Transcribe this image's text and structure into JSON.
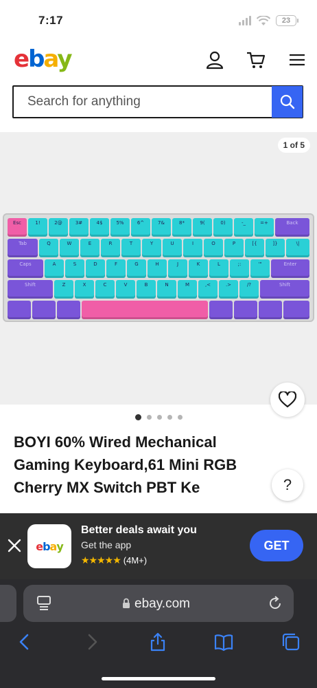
{
  "status": {
    "time": "7:17",
    "battery": "23"
  },
  "header": {
    "logo": "ebay",
    "logo_letters": [
      "e",
      "b",
      "a",
      "y"
    ]
  },
  "search": {
    "placeholder": "Search for anything"
  },
  "gallery": {
    "counter": "1 of 5",
    "total_images": 5,
    "current_index": 1
  },
  "product": {
    "title": "BOYI 60% Wired Mechanical Gaming Keyboard,61 Mini RGB Cherry MX Switch PBT Ke"
  },
  "help": {
    "label": "?"
  },
  "app_banner": {
    "title": "Better deals await you",
    "subtitle": "Get the app",
    "logo": "ebay",
    "stars": "★★★★★",
    "rating_count": "(4M+)",
    "cta": "GET"
  },
  "browser": {
    "url": "ebay.com"
  },
  "colors": {
    "accent": "#3665f3",
    "ebay_red": "#e53238",
    "ebay_blue": "#0064d2",
    "ebay_yellow": "#f5af02",
    "ebay_green": "#86b817"
  }
}
